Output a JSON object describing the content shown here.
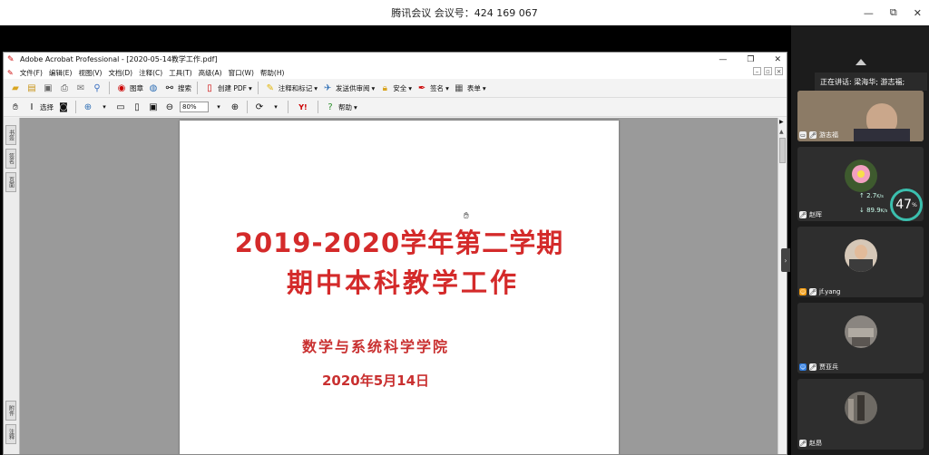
{
  "meeting": {
    "title": "腾讯会议 会议号：424 169 067",
    "minimize": "—",
    "restore": "⧉",
    "close": "✕"
  },
  "acrobat": {
    "window_title": "Adobe Acrobat Professional - [2020-05-14教学工作.pdf]",
    "menu": [
      "文件(F)",
      "编辑(E)",
      "视图(V)",
      "文档(D)",
      "注释(C)",
      "工具(T)",
      "高级(A)",
      "窗口(W)",
      "帮助(H)"
    ],
    "toolbar1": {
      "image": "图章",
      "search": "搜索",
      "create_pdf": "创建 PDF",
      "comment": "注释和标记",
      "review": "发送供审阅",
      "security": "安全",
      "sign": "签名",
      "forms": "表单"
    },
    "toolbar2": {
      "select": "选择",
      "zoom": "80%",
      "help": "帮助"
    },
    "left_tabs": [
      "书签",
      "签名",
      "页面",
      "附件",
      "注释"
    ]
  },
  "document": {
    "title_line1": "2019-2020学年第二学期",
    "title_line2": "期中本科教学工作",
    "school": "数学与系统科学学院",
    "date": "2020年5月14日"
  },
  "participants": {
    "speaking": "正在讲话: 梁海华; 游志福;",
    "tiles": [
      {
        "name": "游志福"
      },
      {
        "name": "赵晖",
        "upload": "2.7",
        "download": "89.9",
        "cpu": "47"
      },
      {
        "name": "jf.yang"
      },
      {
        "name": "贾亚兵"
      },
      {
        "name": "赵昂"
      }
    ],
    "speed_unit": "K/s",
    "cpu_unit": "%"
  }
}
